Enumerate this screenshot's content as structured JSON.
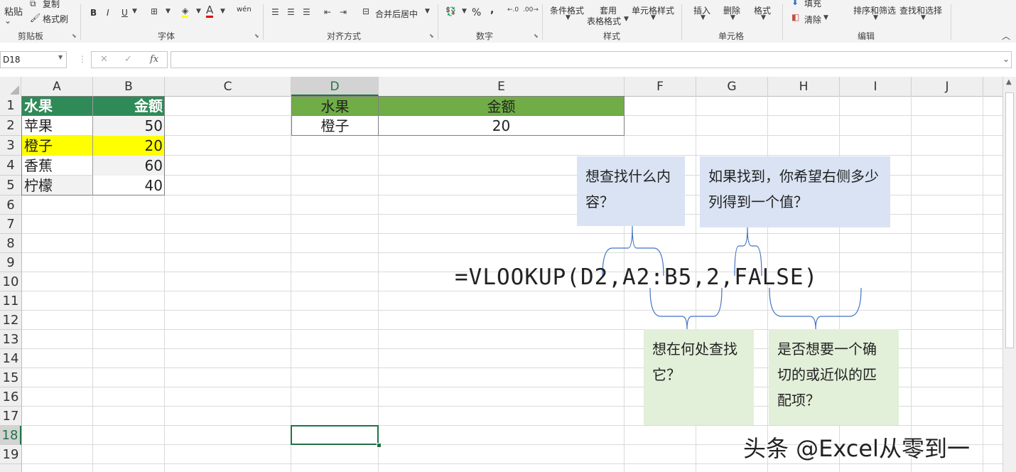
{
  "ribbon": {
    "clipboard": {
      "paste": "粘贴",
      "copy": "复制",
      "format_painter": "格式刷",
      "group": "剪贴板"
    },
    "font": {
      "bold": "B",
      "italic": "I",
      "underline": "U",
      "group": "字体",
      "wen": "wén"
    },
    "alignment": {
      "merge_center": "合并后居中",
      "group": "对齐方式"
    },
    "number": {
      "percent": "%",
      "comma": ",",
      "group": "数字"
    },
    "styles": {
      "conditional": "条件格式",
      "table_format_1": "套用",
      "table_format_2": "表格格式",
      "cell_styles": "单元格样式",
      "group": "样式"
    },
    "cells": {
      "insert": "插入",
      "delete": "删除",
      "format": "格式",
      "group": "单元格"
    },
    "editing": {
      "fill": "填充",
      "clear": "清除",
      "sort_filter": "排序和筛选",
      "find_select": "查找和选择",
      "group": "编辑"
    }
  },
  "name_box": "D18",
  "formula_bar": {
    "cancel": "✕",
    "enter": "✓",
    "fx": "fx",
    "value": ""
  },
  "columns": [
    "A",
    "B",
    "C",
    "D",
    "E",
    "F",
    "G",
    "H",
    "I",
    "J"
  ],
  "rows": [
    "1",
    "2",
    "3",
    "4",
    "5",
    "6",
    "7",
    "8",
    "9",
    "10",
    "11",
    "12",
    "13",
    "14",
    "15",
    "16",
    "17",
    "18",
    "19"
  ],
  "table1": {
    "headers": [
      "水果",
      "金额"
    ],
    "rows": [
      [
        "苹果",
        "50"
      ],
      [
        "橙子",
        "20"
      ],
      [
        "香蕉",
        "60"
      ],
      [
        "柠檬",
        "40"
      ]
    ]
  },
  "table2": {
    "headers": [
      "水果",
      "金额"
    ],
    "row": [
      "橙子",
      "20"
    ]
  },
  "formula": "=VLOOKUP(D2,A2:B5,2,FALSE)",
  "callouts": {
    "what": "想查找什么内容？",
    "cols": "如果找到，你希望右侧多少列得到一个值？",
    "where": "想在何处查找它？",
    "exact": "是否想要一个确切的或近似的匹配项？"
  },
  "watermark": "头条 @Excel从零到一",
  "colors": {
    "header_green": "#2e8b57",
    "lookup_green": "#70ad47",
    "highlight_yellow": "#ffff00",
    "callout_blue": "#dae3f3",
    "callout_green": "#e2efd9",
    "selection_green": "#217346"
  }
}
